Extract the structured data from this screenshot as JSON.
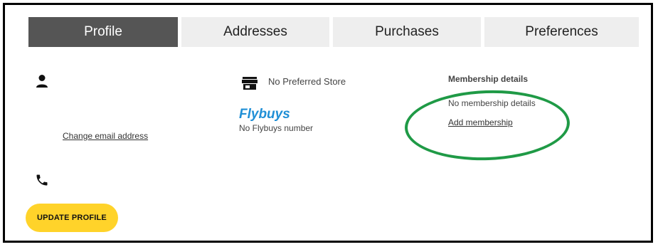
{
  "tabs": [
    {
      "label": "Profile"
    },
    {
      "label": "Addresses"
    },
    {
      "label": "Purchases"
    },
    {
      "label": "Preferences"
    }
  ],
  "profile": {
    "change_email_label": "Change email address",
    "update_button_label": "UPDATE PROFILE"
  },
  "store": {
    "label": "No Preferred Store"
  },
  "flybuys": {
    "logo_text": "Flybuys",
    "status": "No Flybuys number"
  },
  "membership": {
    "title": "Membership details",
    "status": "No membership details",
    "add_label": "Add membership"
  },
  "colors": {
    "active_tab": "#555555",
    "inactive_tab": "#eeeeee",
    "button": "#ffd32a",
    "flybuys": "#1f8fd6",
    "highlight_circle": "#1f9a46"
  },
  "icons": [
    "user-icon",
    "phone-icon",
    "store-icon"
  ]
}
